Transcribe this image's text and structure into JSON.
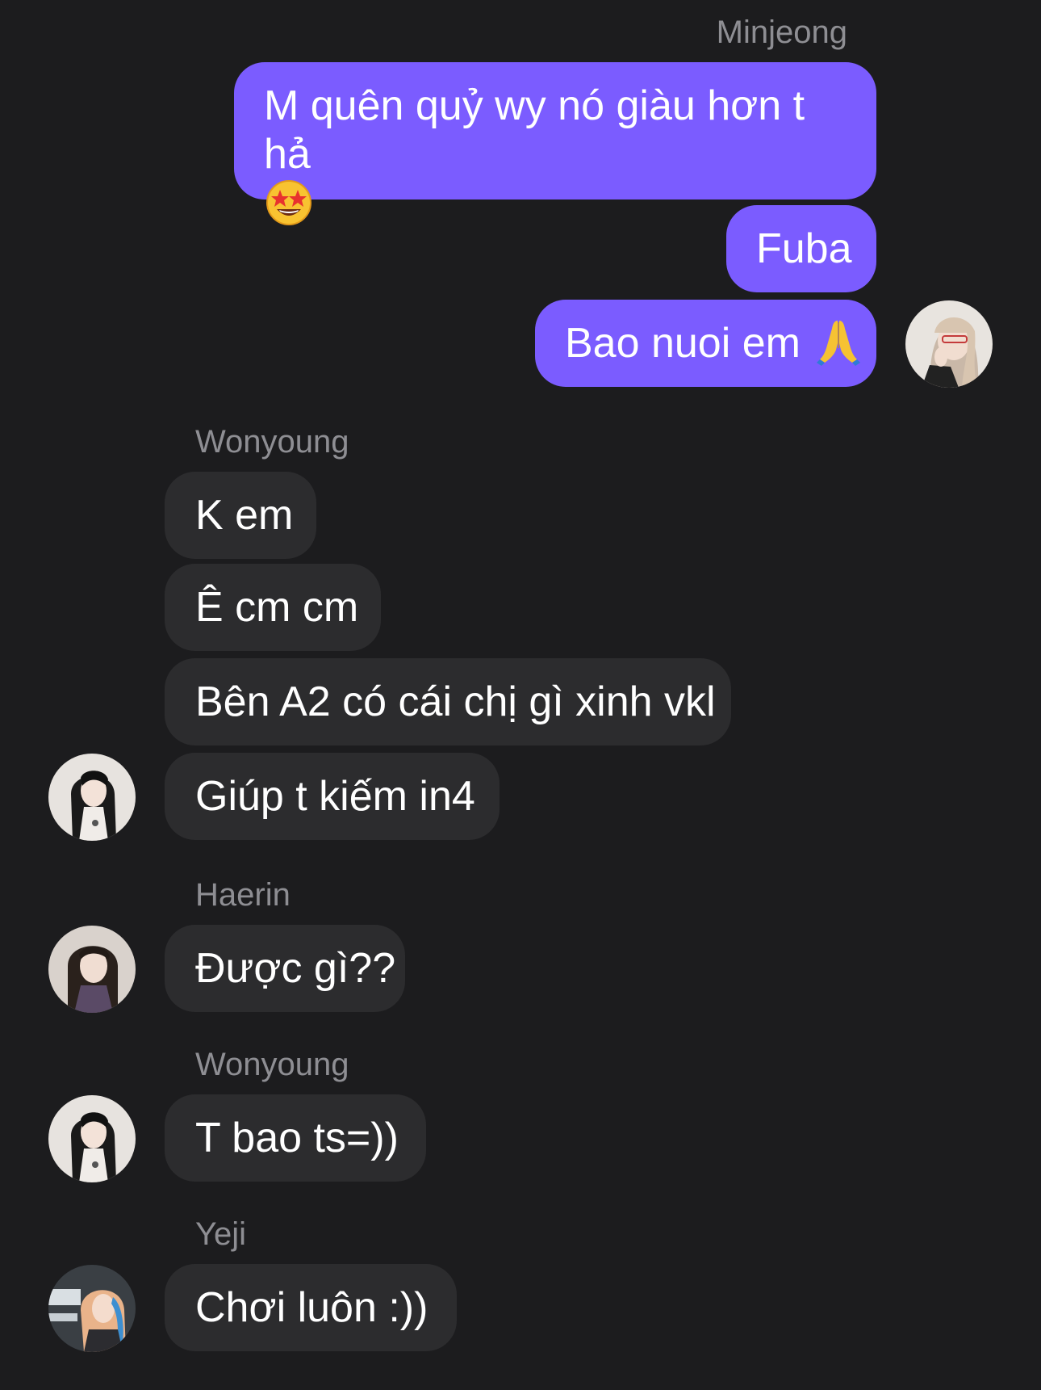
{
  "colors": {
    "background": "#1c1c1e",
    "outgoing_bubble": "#7b5cff",
    "incoming_bubble": "#2c2c2e",
    "sender_name": "#8e8e93",
    "text": "#ffffff"
  },
  "outgoing": {
    "sender": "Minjeong",
    "messages": [
      {
        "text": "M quên quỷ wy nó giàu hơn t hả",
        "emoji": "star-struck-emoji"
      },
      {
        "text": "Fuba"
      },
      {
        "text": "Bao nuoi em",
        "emoji": "folded-hands-emoji"
      }
    ],
    "avatar": "minjeong-avatar"
  },
  "groups": [
    {
      "sender": "Wonyoung",
      "avatar": "wonyoung-avatar",
      "messages": [
        "K em",
        "Ê cm cm",
        "Bên A2 có cái chị gì xinh vkl",
        "Giúp t kiếm in4"
      ]
    },
    {
      "sender": "Haerin",
      "avatar": "haerin-avatar",
      "messages": [
        "Được gì??"
      ]
    },
    {
      "sender": "Wonyoung",
      "avatar": "wonyoung-avatar",
      "messages": [
        "T bao ts=))"
      ]
    },
    {
      "sender": "Yeji",
      "avatar": "yeji-avatar",
      "messages": [
        "Chơi luôn :))"
      ]
    }
  ]
}
